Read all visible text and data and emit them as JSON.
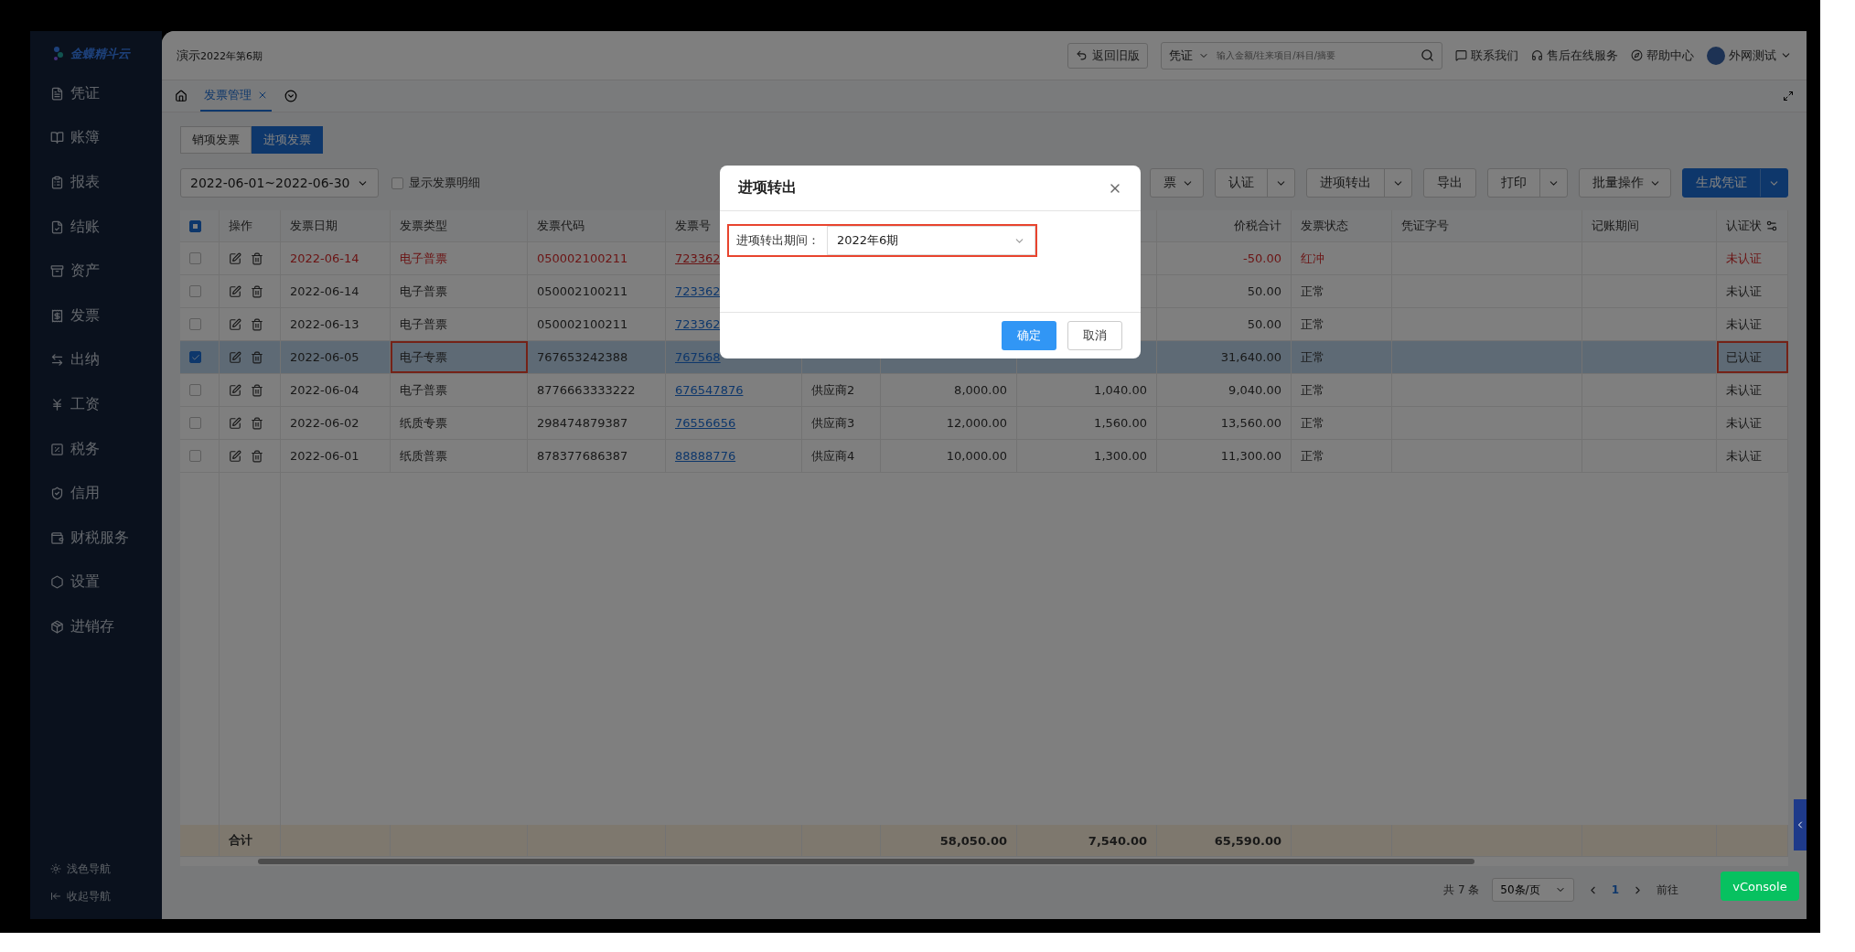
{
  "sidebar": {
    "logo": "金蝶精斗云",
    "items": [
      {
        "label": "凭证"
      },
      {
        "label": "账簿"
      },
      {
        "label": "报表"
      },
      {
        "label": "结账"
      },
      {
        "label": "资产"
      },
      {
        "label": "发票"
      },
      {
        "label": "出纳"
      },
      {
        "label": "工资"
      },
      {
        "label": "税务"
      },
      {
        "label": "信用"
      },
      {
        "label": "财税服务"
      },
      {
        "label": "设置"
      },
      {
        "label": "进销存"
      }
    ],
    "footer": [
      {
        "label": "浅色导航"
      },
      {
        "label": "收起导航"
      }
    ]
  },
  "header": {
    "account": "演示",
    "period": "2022年第6期",
    "back_button": "返回旧版",
    "search_scope": "凭证",
    "search_placeholder": "输入金额/往来项目/科目/摘要",
    "links": [
      "联系我们",
      "售后在线服务",
      "帮助中心"
    ],
    "user": "外网测试"
  },
  "page_tabs": [
    {
      "label": "发票管理",
      "selected": true
    }
  ],
  "invoice_tabs": [
    {
      "label": "销项发票",
      "selected": false
    },
    {
      "label": "进项发票",
      "selected": true
    }
  ],
  "filter": {
    "date_range": "2022-06-01~2022-06-30",
    "detail_checkbox": {
      "label": "显示发票明细",
      "checked": false
    }
  },
  "toolbar": [
    {
      "label": "票",
      "kind": "dropdown"
    },
    {
      "label": "认证",
      "kind": "split"
    },
    {
      "label": "进项转出",
      "kind": "split"
    },
    {
      "label": "导出",
      "kind": "plain"
    },
    {
      "label": "打印",
      "kind": "split"
    },
    {
      "label": "批量操作",
      "kind": "dropdown"
    },
    {
      "label": "生成凭证",
      "kind": "primary"
    }
  ],
  "table": {
    "select_all": {
      "indeterminate": true
    },
    "columns": [
      {
        "label": "操作"
      },
      {
        "label": "发票日期"
      },
      {
        "label": "发票类型"
      },
      {
        "label": "发票代码"
      },
      {
        "label": "发票号"
      },
      {},
      {},
      {},
      {
        "label": "价税合计"
      },
      {
        "label": "发票状态"
      },
      {
        "label": "凭证字号"
      },
      {
        "label": "记账期间"
      },
      {
        "label": "认证状"
      }
    ],
    "rows": [
      {
        "checked": false,
        "reversed": true,
        "date": "2022-06-14",
        "type": "电子普票",
        "code": "050002100211",
        "number": "723362",
        "total": "-50.00",
        "status": "红冲",
        "cert": "未认证"
      },
      {
        "checked": false,
        "reversed": false,
        "date": "2022-06-14",
        "type": "电子普票",
        "code": "050002100211",
        "number": "723362",
        "total": "50.00",
        "status": "正常",
        "cert": "未认证"
      },
      {
        "checked": false,
        "reversed": false,
        "date": "2022-06-13",
        "type": "电子普票",
        "code": "050002100211",
        "number": "723362",
        "total": "50.00",
        "status": "正常",
        "cert": "未认证"
      },
      {
        "checked": true,
        "reversed": false,
        "marked": true,
        "date": "2022-06-05",
        "type": "电子专票",
        "code": "767653242388",
        "number": "767568",
        "total": "31,640.00",
        "status": "正常",
        "cert": "已认证"
      },
      {
        "checked": false,
        "reversed": false,
        "date": "2022-06-04",
        "type": "电子普票",
        "code": "8776663333222",
        "number": "676547876",
        "supplier": "供应商2",
        "amount": "8,000.00",
        "tax": "1,040.00",
        "total": "9,040.00",
        "status": "正常",
        "cert": "未认证"
      },
      {
        "checked": false,
        "reversed": false,
        "date": "2022-06-02",
        "type": "纸质专票",
        "code": "298474879387",
        "number": "76556656",
        "supplier": "供应商3",
        "amount": "12,000.00",
        "tax": "1,560.00",
        "total": "13,560.00",
        "status": "正常",
        "cert": "未认证"
      },
      {
        "checked": false,
        "reversed": false,
        "date": "2022-06-01",
        "type": "纸质普票",
        "code": "878377686387",
        "number": "88888776",
        "supplier": "供应商4",
        "amount": "10,000.00",
        "tax": "1,300.00",
        "total": "11,300.00",
        "status": "正常",
        "cert": "未认证"
      }
    ],
    "summary": {
      "label": "合计",
      "amount": "58,050.00",
      "tax": "7,540.00",
      "total": "65,590.00"
    }
  },
  "pagination": {
    "count": "共 7 条",
    "page_size": "50条/页",
    "page": "1",
    "goto": "前往"
  },
  "vconsole": "vConsole",
  "dialog": {
    "title": "进项转出",
    "field_label": "进项转出期间：",
    "field_value": "2022年6期",
    "marked": true,
    "confirm": "确定",
    "cancel": "取消"
  }
}
